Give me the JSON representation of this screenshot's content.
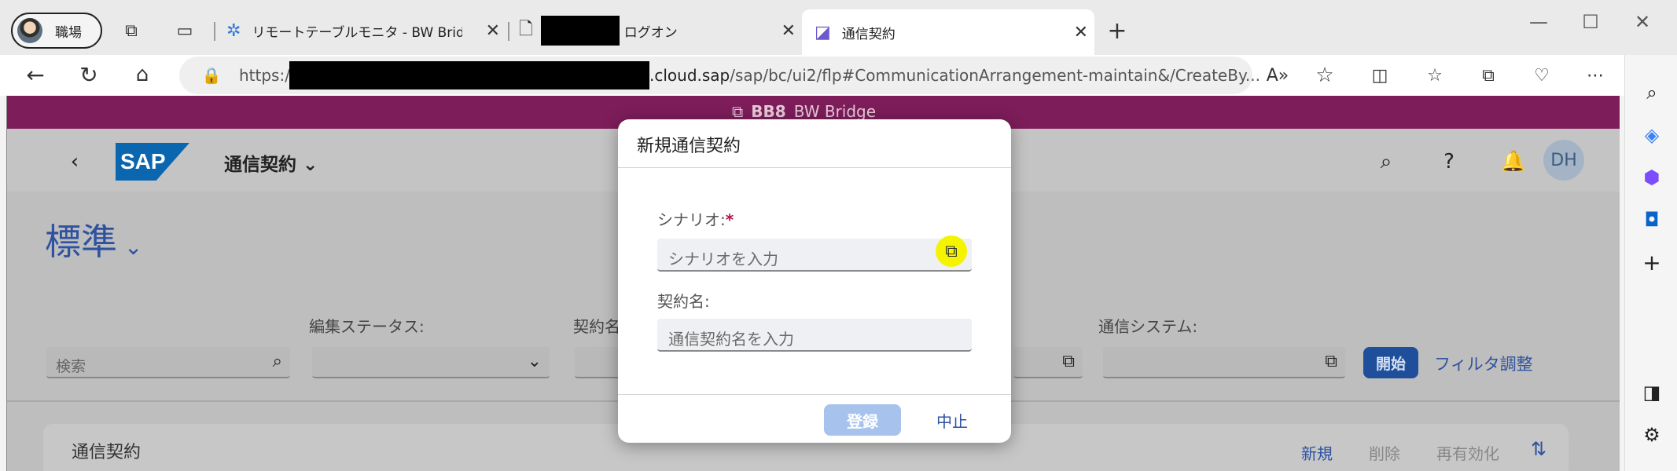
{
  "browser": {
    "profile_name": "職場",
    "tabs": [
      {
        "label": "リモートテーブルモニタ - BW Bridge (S"
      },
      {
        "label": "ログオン"
      },
      {
        "label": "通信契約"
      }
    ],
    "new_tab": "+",
    "close_glyph": "✕",
    "url_prefix": "https://",
    "url_main": ".cloud.sap",
    "url_rest": "/sap/bc/ui2/flp#CommunicationArrangement-maintain&/CreateBy..."
  },
  "sap": {
    "system_id": "BB8",
    "system_name": "BW Bridge",
    "logo_text": "SAP",
    "app_title": "通信契約",
    "user_initials": "DH",
    "variant_name": "標準",
    "filters": {
      "search_placeholder": "検索",
      "edit_status_label": "編集ステータス:",
      "arrangement_label": "契約名",
      "comm_system_label": "通信システム:"
    },
    "go_button": "開始",
    "adapt_filters": "フィルタ調整",
    "table": {
      "title": "通信契約",
      "actions": [
        "新規",
        "削除",
        "再有効化"
      ]
    }
  },
  "dialog": {
    "title": "新規通信契約",
    "scenario_label": "シナリオ:",
    "required_mark": "*",
    "scenario_placeholder": "シナリオを入力",
    "name_label": "契約名:",
    "name_placeholder": "通信契約名を入力",
    "register_button": "登録",
    "cancel_button": "中止"
  },
  "colors": {
    "sap_system_bar": "#7d1d5a",
    "sap_blue": "#2e52a0",
    "highlight": "#f4f400"
  }
}
